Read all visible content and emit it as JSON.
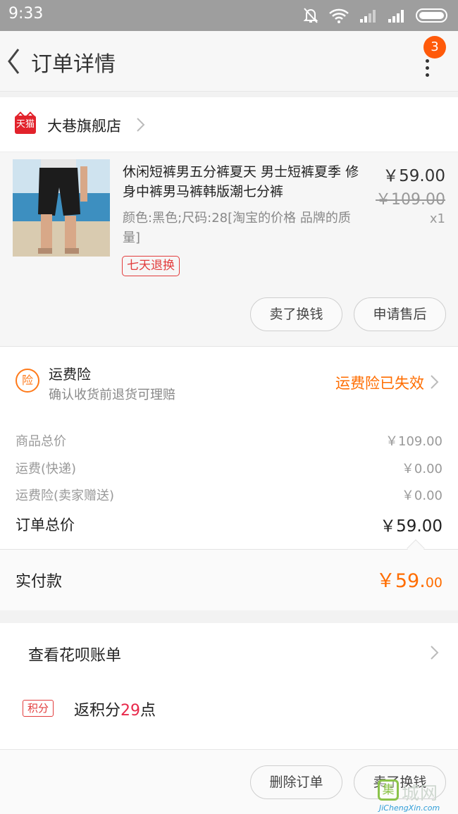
{
  "status_bar": {
    "time": "9:33"
  },
  "header": {
    "title": "订单详情",
    "notification_count": "3"
  },
  "shop": {
    "logo_text": "天猫",
    "name": "大巷旗舰店"
  },
  "item": {
    "title": "休闲短裤男五分裤夏天 男士短裤夏季 修身中裤男马裤韩版潮七分裤",
    "spec": "颜色:黑色;尺码:28[淘宝的价格 品牌的质量]",
    "tag": "七天退换",
    "price": "￥59.00",
    "original_price": "￥109.00",
    "quantity": "x1",
    "buttons": {
      "sell": "卖了换钱",
      "after_sale": "申请售后"
    }
  },
  "insurance": {
    "icon_text": "险",
    "title": "运费险",
    "subtitle": "确认收货前退货可理赔",
    "status": "运费险已失效"
  },
  "summary": {
    "rows": [
      {
        "label": "商品总价",
        "value": "￥109.00"
      },
      {
        "label": "运费(快递)",
        "value": "￥0.00"
      },
      {
        "label": "运费险(卖家赠送)",
        "value": "￥0.00"
      }
    ],
    "total_label": "订单总价",
    "total_value": "￥59.00"
  },
  "paid": {
    "label": "实付款",
    "value_main": "￥59.",
    "value_decimal": "00"
  },
  "huabei": {
    "label": "查看花呗账单"
  },
  "points": {
    "tag": "积分",
    "prefix": "返积分",
    "number": "29",
    "suffix": "点"
  },
  "bottom_bar": {
    "delete": "删除订单",
    "sell": "卖了换钱"
  },
  "watermark": {
    "icon_text": "集",
    "cn": "城网",
    "en": "JiChengXin.com"
  },
  "colors": {
    "accent_orange": "#ff6d00",
    "tag_red": "#e23c3c",
    "badge": "#ff5a0a"
  }
}
